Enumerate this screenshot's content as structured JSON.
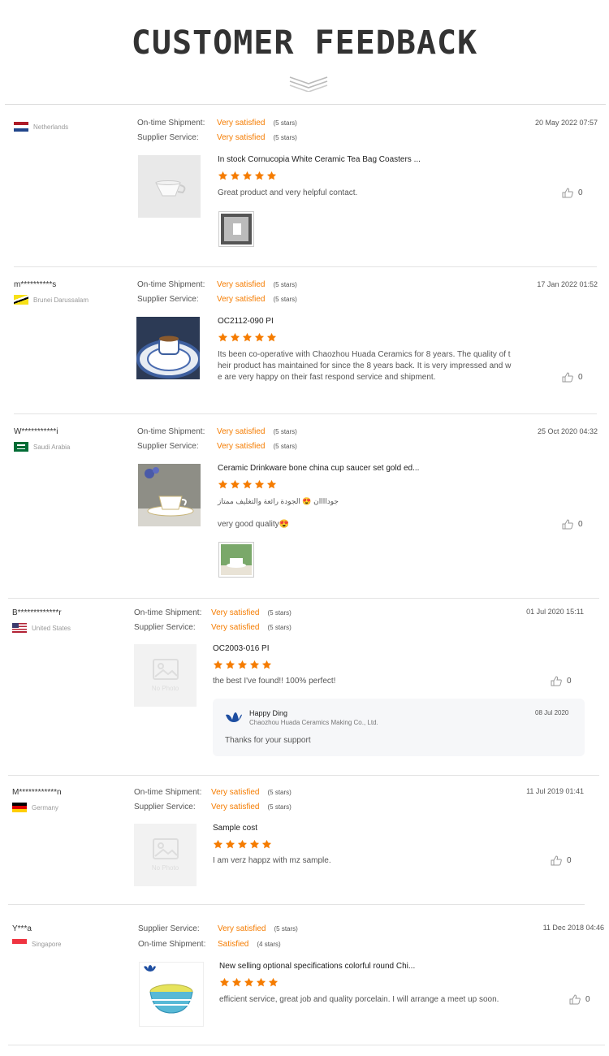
{
  "page_title": "CUSTOMER FEEDBACK",
  "colors": {
    "accent": "#f57c00",
    "star": "#f57c00"
  },
  "reviews": [
    {
      "user": "",
      "country": "Netherlands",
      "flag": "netherlands-flag",
      "ratings": [
        {
          "label": "On-time Shipment:",
          "value": "Very satisfied",
          "count": "(5 stars)"
        },
        {
          "label": "Supplier Service:",
          "value": "Very satisfied",
          "count": "(5 stars)"
        }
      ],
      "date": "20 May 2022 07:57",
      "product": "In stock Cornucopia White Ceramic Tea Bag Coasters ...",
      "stars": 5,
      "comment": "Great product and very helpful contact.",
      "likes": "0"
    },
    {
      "user": "m**********s",
      "country": "Brunei Darussalam",
      "flag": "brunei-flag",
      "ratings": [
        {
          "label": "On-time Shipment:",
          "value": "Very satisfied",
          "count": "(5 stars)"
        },
        {
          "label": "Supplier Service:",
          "value": "Very satisfied",
          "count": "(5 stars)"
        }
      ],
      "date": "17 Jan 2022 01:52",
      "product": "OC2112-090 PI",
      "stars": 5,
      "comment_lines": [
        "Its been co-operative with Chaozhou Huada Ceramics for 8 years. The quality of t",
        "heir product has maintained for since the 8 years back. It is very impressed and w",
        "e are very happy on their fast respond service and shipment."
      ],
      "likes": "0"
    },
    {
      "user": "W***********i",
      "country": "Saudi Arabia",
      "flag": "saudi-flag",
      "ratings": [
        {
          "label": "On-time Shipment:",
          "value": "Very satisfied",
          "count": "(5 stars)"
        },
        {
          "label": "Supplier Service:",
          "value": "Very satisfied",
          "count": "(5 stars)"
        }
      ],
      "date": "25 Oct 2020 04:32",
      "product": "Ceramic Drinkware bone china cup saucer set gold ed...",
      "stars": 5,
      "comment_arabic": "جوداااان 😍 الجودة رائعة والتغليف ممتاز",
      "comment": "very good quality😍",
      "likes": "0"
    },
    {
      "user": "B*************r",
      "country": "United States",
      "flag": "usa-flag",
      "ratings": [
        {
          "label": "On-time Shipment:",
          "value": "Very satisfied",
          "count": "(5 stars)"
        },
        {
          "label": "Supplier Service:",
          "value": "Very satisfied",
          "count": "(5 stars)"
        }
      ],
      "date": "01 Jul 2020 15:11",
      "thumb_text": "No Photo",
      "product": "OC2003-016 PI",
      "stars": 5,
      "comment": "the best I've found!! 100% perfect!",
      "likes": "0",
      "reply": {
        "name": "Happy Ding",
        "company": "Chaozhou Huada Ceramics Making Co., Ltd.",
        "date": "08 Jul 2020",
        "text": "Thanks for your support"
      }
    },
    {
      "user": "M************n",
      "country": "Germany",
      "flag": "germany-flag",
      "ratings": [
        {
          "label": "On-time Shipment:",
          "value": "Very satisfied",
          "count": "(5 stars)"
        },
        {
          "label": "Supplier Service:",
          "value": "Very satisfied",
          "count": "(5 stars)"
        }
      ],
      "date": "11 Jul 2019 01:41",
      "thumb_text": "No Photo",
      "product": "Sample cost",
      "stars": 5,
      "comment": "I am verz happz with mz sample.",
      "likes": "0"
    },
    {
      "user": "Y***a",
      "country": "Singapore",
      "flag": "singapore-flag",
      "ratings": [
        {
          "label": "Supplier Service:",
          "value": "Very satisfied",
          "count": "(5 stars)"
        },
        {
          "label": "On-time Shipment:",
          "value": "Satisfied",
          "count": "(4 stars)"
        }
      ],
      "date": "11 Dec 2018 04:46",
      "product": "New selling optional specifications colorful round Chi...",
      "stars": 5,
      "comment": "efficient service, great job and quality porcelain. I will arrange a meet up soon.",
      "likes": "0"
    }
  ]
}
